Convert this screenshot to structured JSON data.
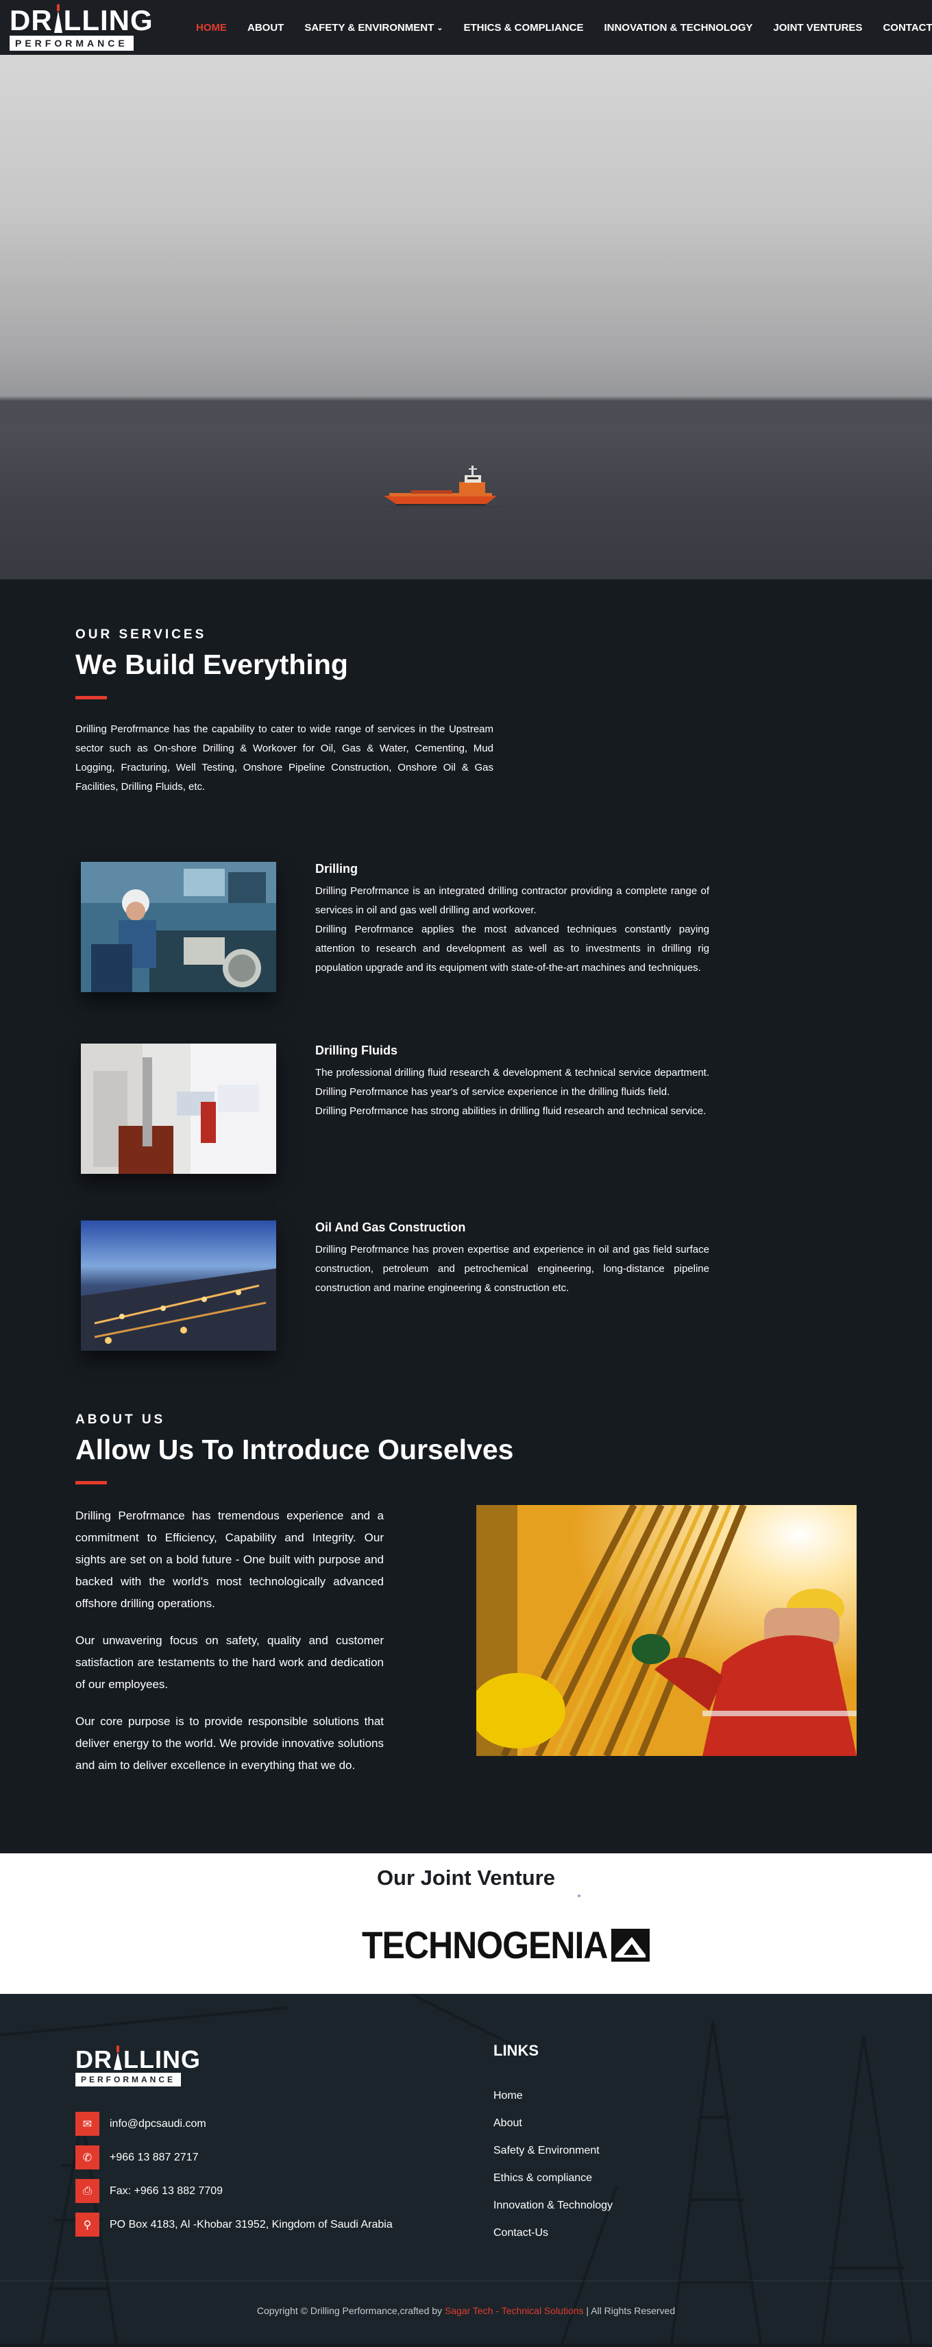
{
  "header": {
    "logo_top": [
      "DR",
      "LLING"
    ],
    "logo_bottom": "PERFORMANCE",
    "nav": [
      {
        "label": "HOME",
        "active": true
      },
      {
        "label": "ABOUT"
      },
      {
        "label": "SAFETY & ENVIRONMENT",
        "has_dropdown": true
      },
      {
        "label": "ETHICS & COMPLIANCE"
      },
      {
        "label": "INNOVATION & TECHNOLOGY"
      },
      {
        "label": "JOINT VENTURES"
      },
      {
        "label": "CONTACT"
      }
    ]
  },
  "services": {
    "eyebrow": "OUR SERVICES",
    "title": "We Build Everything",
    "intro": "Drilling Perofrmance has the capability to cater to wide range of services in the Upstream sector such as On-shore Drilling & Workover for Oil, Gas & Water, Cementing, Mud Logging, Fracturing, Well Testing, Onshore Pipeline Construction, Onshore Oil & Gas Facilities, Drilling Fluids, etc.",
    "items": [
      {
        "title": "Drilling",
        "desc": [
          "Drilling Perofrmance is an integrated drilling contractor providing a complete range of services in oil and gas well drilling and workover.",
          "Drilling Perofrmance applies the most advanced techniques constantly paying attention to research and development as well as to investments in drilling rig population upgrade and its equipment with state-of-the-art machines and techniques."
        ]
      },
      {
        "title": "Drilling Fluids",
        "desc": [
          "The professional drilling fluid research & development & technical service department. Drilling Perofrmance has year's of service experience in the drilling fluids field.",
          "Drilling Perofrmance has strong abilities in drilling fluid research and technical service."
        ]
      },
      {
        "title": "Oil And Gas Construction",
        "desc": [
          "Drilling Perofrmance has proven expertise and experience in oil and gas field surface construction, petroleum and petrochemical engineering, long-distance pipeline construction and marine engineering & construction etc."
        ]
      }
    ]
  },
  "about": {
    "eyebrow": "ABOUT US",
    "title": "Allow Us To Introduce Ourselves",
    "paragraphs": [
      "Drilling Perofrmance has tremendous experience and a commitment to Efficiency, Capability and Integrity. Our sights are set on a bold future - One built with purpose and backed with the world's most technologically advanced offshore drilling operations.",
      "Our unwavering focus on safety, quality and customer satisfaction are testaments to the hard work and dedication of our employees.",
      "Our core purpose is to provide responsible solutions that deliver energy to the world. We provide innovative solutions and aim to deliver excellence in everything that we do."
    ]
  },
  "joint_venture": {
    "title": "Our Joint Venture",
    "partner": "TECHNOGENIA"
  },
  "footer": {
    "contacts": [
      {
        "icon": "envelope-icon",
        "glyph": "✉",
        "text": "info@dpcsaudi.com"
      },
      {
        "icon": "phone-icon",
        "glyph": "✆",
        "text": "+966 13 887 2717"
      },
      {
        "icon": "fax-icon",
        "glyph": "⎙",
        "text": "Fax: +966 13 882 7709"
      },
      {
        "icon": "map-pin-icon",
        "glyph": "⚲",
        "text": "PO Box 4183, Al -Khobar 31952, Kingdom of Saudi Arabia"
      }
    ],
    "links_title": "LINKS",
    "links": [
      "Home",
      "About",
      "Safety & Environment",
      "Ethics & compliance",
      "Innovation & Technology",
      "Contact-Us"
    ],
    "copyright_pre": "Copyright © Drilling Performance,crafted by ",
    "copyright_link": "Sagar Tech - Technical Solutions",
    "copyright_post": " | All Rights Reserved"
  },
  "colors": {
    "accent": "#e23b2e",
    "dark_bg": "#161b20",
    "header_bg": "#1b1f24"
  }
}
